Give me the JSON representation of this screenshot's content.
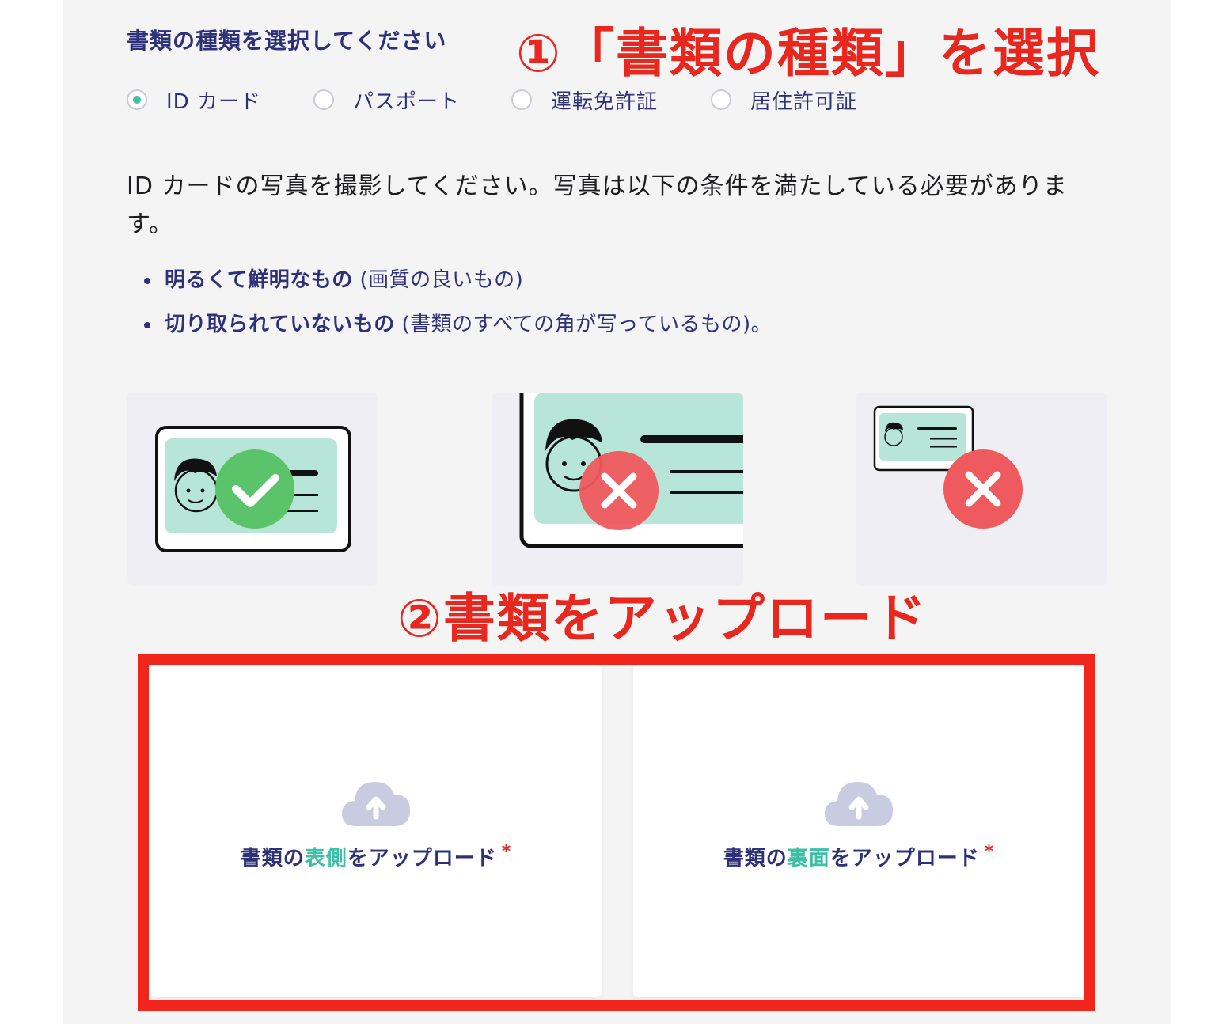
{
  "document_type": {
    "title": "書類の種類を選択してください",
    "options": [
      {
        "label": "ID カード",
        "selected": true
      },
      {
        "label": "パスポート",
        "selected": false
      },
      {
        "label": "運転免許証",
        "selected": false
      },
      {
        "label": "居住許可証",
        "selected": false
      }
    ]
  },
  "instructions": "ID カードの写真を撮影してください。写真は以下の条件を満たしている必要があります。",
  "requirements": [
    {
      "strong": "明るくて鮮明なもの",
      "note": " (画質の良いもの)"
    },
    {
      "strong": "切り取られていないもの",
      "note": " (書類のすべての角が写っているもの)。"
    }
  ],
  "examples": [
    {
      "status": "ok",
      "icon": "check-icon"
    },
    {
      "status": "ng",
      "icon": "cross-icon"
    },
    {
      "status": "ng",
      "icon": "cross-icon"
    }
  ],
  "annotations": {
    "step1": "①「書類の種類」を選択",
    "step2": "②書類をアップロード"
  },
  "upload": {
    "front": {
      "prefix": "書類の",
      "accent": "表側",
      "suffix": "をアップロード",
      "required": "*"
    },
    "back": {
      "prefix": "書類の",
      "accent": "裏面",
      "suffix": "をアップロード",
      "required": "*"
    }
  },
  "colors": {
    "accent": "#3ebfa6",
    "primary_text": "#2e3179",
    "annotation_red": "#e8281f",
    "ok_green": "#5bc46a",
    "ng_red": "#ef5a5f"
  }
}
